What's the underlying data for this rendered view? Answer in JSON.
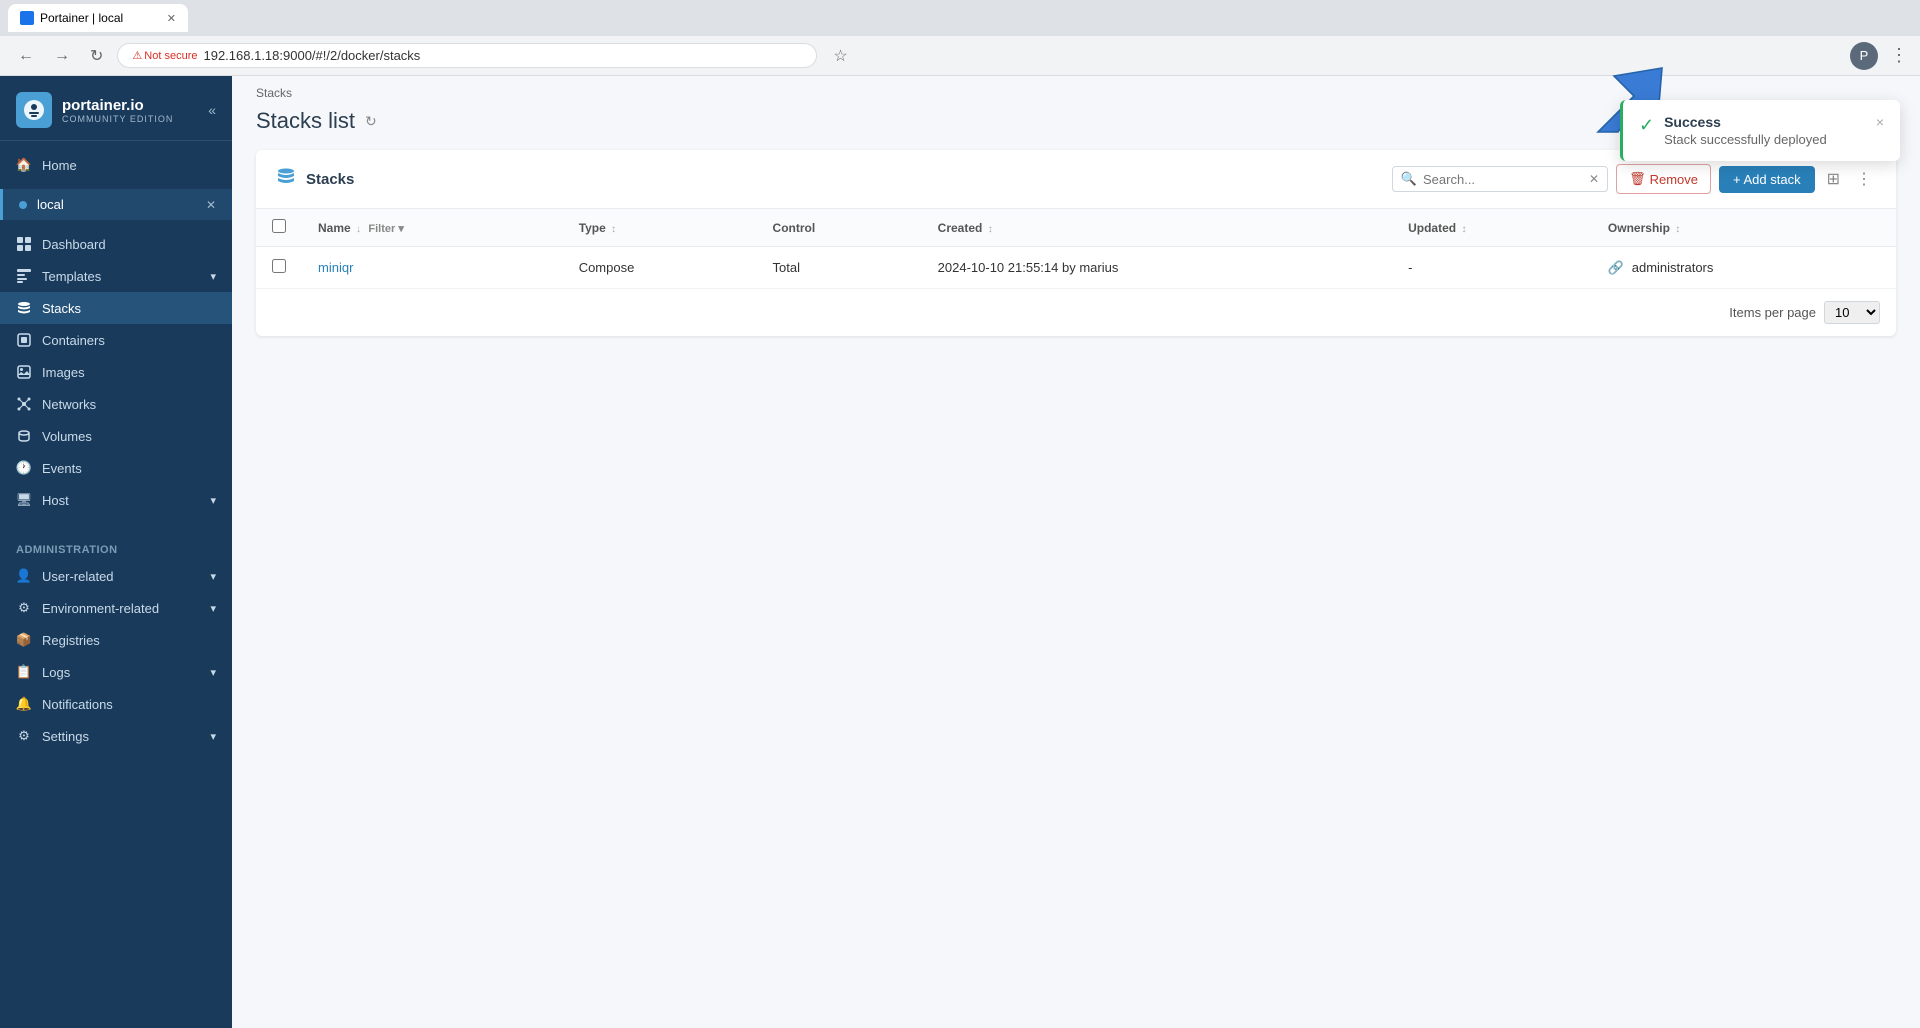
{
  "browser": {
    "tab_title": "Portainer | local",
    "address": "192.168.1.18:9000/#!/2/docker/stacks",
    "not_secure_label": "Not secure"
  },
  "sidebar": {
    "logo_main": "portainer.io",
    "logo_sub": "Community Edition",
    "home_label": "Home",
    "environment_name": "local",
    "menu_items": [
      {
        "label": "Dashboard",
        "icon": "dashboard"
      },
      {
        "label": "Templates",
        "icon": "templates",
        "has_chevron": true
      },
      {
        "label": "Stacks",
        "icon": "stacks",
        "active": true
      },
      {
        "label": "Containers",
        "icon": "containers"
      },
      {
        "label": "Images",
        "icon": "images"
      },
      {
        "label": "Networks",
        "icon": "networks"
      },
      {
        "label": "Volumes",
        "icon": "volumes"
      },
      {
        "label": "Events",
        "icon": "events"
      },
      {
        "label": "Host",
        "icon": "host",
        "has_chevron": true
      }
    ],
    "admin_section": "Administration",
    "admin_items": [
      {
        "label": "User-related",
        "has_chevron": true
      },
      {
        "label": "Environment-related",
        "has_chevron": true
      },
      {
        "label": "Registries"
      },
      {
        "label": "Logs",
        "has_chevron": true
      },
      {
        "label": "Notifications"
      },
      {
        "label": "Settings",
        "has_chevron": true
      }
    ]
  },
  "breadcrumb": "Stacks",
  "page_title": "Stacks list",
  "panel": {
    "title": "Stacks",
    "search_placeholder": "Search...",
    "remove_label": "Remove",
    "add_label": "+ Add stack"
  },
  "table": {
    "columns": [
      {
        "label": "Name",
        "sortable": true,
        "filterable": true
      },
      {
        "label": "Type",
        "sortable": true
      },
      {
        "label": "Control"
      },
      {
        "label": "Created",
        "sortable": true
      },
      {
        "label": "Updated",
        "sortable": true
      },
      {
        "label": "Ownership",
        "sortable": true
      }
    ],
    "rows": [
      {
        "name": "miniqr",
        "type": "Compose",
        "control": "Total",
        "created": "2024-10-10 21:55:14 by marius",
        "updated": "-",
        "ownership": "administrators"
      }
    ]
  },
  "pagination": {
    "items_per_page_label": "Items per page",
    "value": "10"
  },
  "notification": {
    "title": "Success",
    "message": "Stack successfully deployed",
    "close_label": "×"
  }
}
